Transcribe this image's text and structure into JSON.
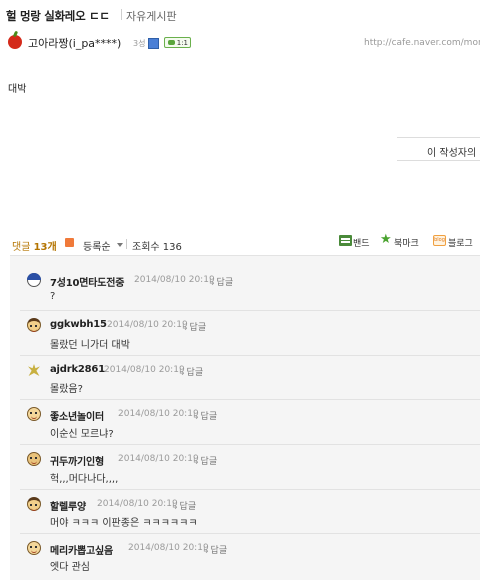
{
  "post": {
    "title": "헐 멍랑 실화레오 ㄷㄷ",
    "board": "자유게시판",
    "author": "고아라짱(i_pa****)",
    "level": "3성",
    "chat_badge": "1:1",
    "url": "http://cafe.naver.com/mon",
    "body": "대박",
    "author_posts_button": "이 작성자의 게"
  },
  "meta": {
    "comments_label": "댓글",
    "comments_count": "13개",
    "sort_label": "등록순",
    "views_label": "조회수",
    "views_count": "136"
  },
  "share": {
    "band": "밴드",
    "bookmark": "북마크",
    "blog_icon": "blog",
    "blog": "블로그"
  },
  "comments": [
    {
      "name": "7성10면타도전중",
      "date": "2014/08/10 20:19",
      "reply": "답글",
      "text": "?",
      "avatar": "cap-icon"
    },
    {
      "name": "ggkwbh15",
      "date": "2014/08/10 20:19",
      "reply": "답글",
      "text": "몰랐던 니가더 대박",
      "avatar": "face-icon"
    },
    {
      "name": "ajdrk2861",
      "date": "2014/08/10 20:19",
      "reply": "답글",
      "text": "몰랐음?",
      "avatar": "spike-icon"
    },
    {
      "name": "좋소년놀이터",
      "date": "2014/08/10 20:19",
      "reply": "답글",
      "text": "이순신 모르냐?",
      "avatar": "face-icon"
    },
    {
      "name": "귀두까기인형",
      "date": "2014/08/10 20:19",
      "reply": "답글",
      "text": "헉,,,머다나다,,,,",
      "avatar": "face-icon"
    },
    {
      "name": "할렐루양",
      "date": "2014/08/10 20:19",
      "reply": "답글",
      "text": "머야 ㅋㅋㅋ 이판종은 ㅋㅋㅋㅋㅋㅋ",
      "avatar": "face-icon"
    },
    {
      "name": "메리카뽑고싶음",
      "date": "2014/08/10 20:19",
      "reply": "답글",
      "text": "엣다 관심",
      "avatar": "face-icon"
    }
  ]
}
